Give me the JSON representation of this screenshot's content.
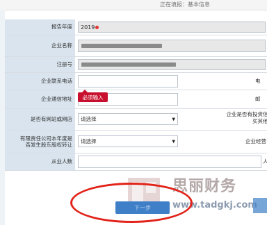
{
  "header": {
    "status": "正在填报：基本信息"
  },
  "form": {
    "report_year_label": "报告年度",
    "report_year_value": "2019",
    "company_name_label": "企业名称",
    "reg_no_label": "注册号",
    "phone_label": "企业联系电话",
    "phone_right_label": "电",
    "address_label": "企业通信地址",
    "address_right_label": "邮",
    "tip": "必须输入",
    "website_label": "是否有网站或网店",
    "website_select": "请选择",
    "invest_label_1": "企业是否有投资信息",
    "invest_label_2": "买其他公",
    "equity_label_1": "有限责任公司本年度是",
    "equity_label_2": "否发生股东股权转让",
    "equity_select": "请选择",
    "operate_label": "企业经营",
    "employees_label": "从业人数",
    "employees_unit": "人"
  },
  "footer": {
    "button_label": "下一步"
  },
  "watermark": {
    "brand": "思丽财务",
    "url": "www.tadgkj.com"
  },
  "colors": {
    "label_bg": "#d9e4ee",
    "button": "#3e7fc8",
    "tip": "#c8102e",
    "circle": "#e2231a"
  }
}
